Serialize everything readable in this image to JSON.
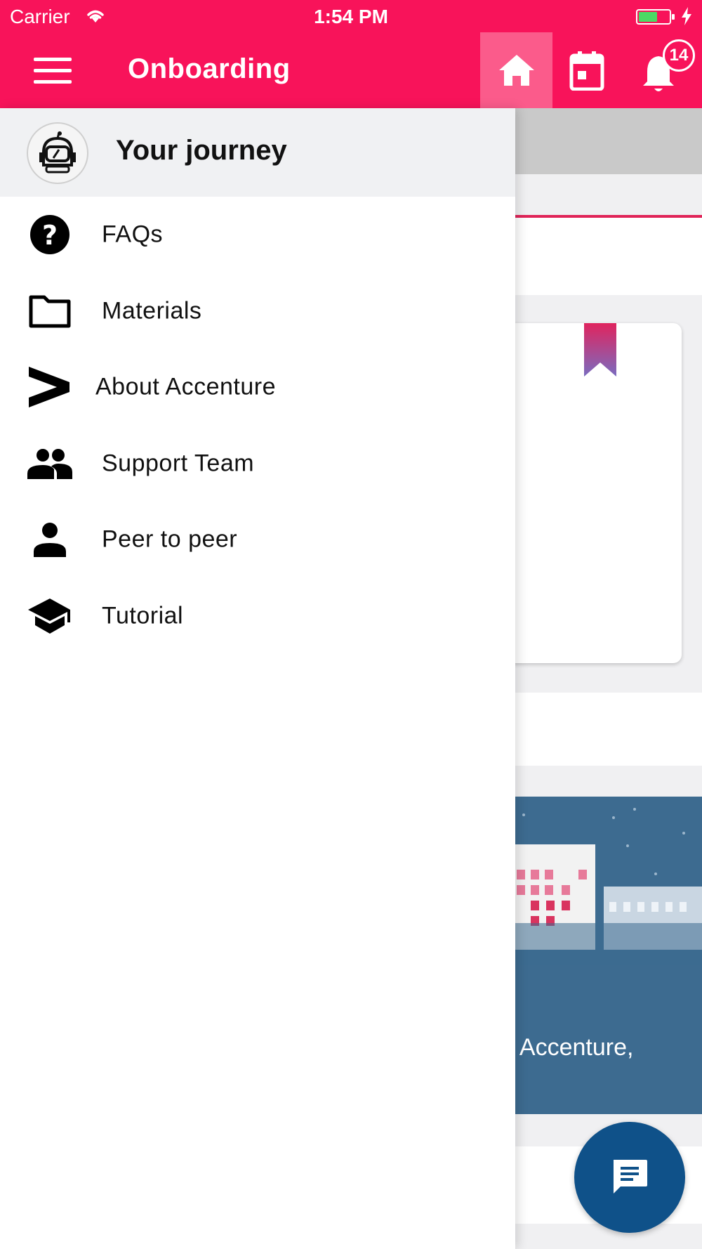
{
  "status_bar": {
    "carrier": "Carrier",
    "time": "1:54 PM"
  },
  "header": {
    "title": "Onboarding",
    "notification_count": "14",
    "colors": {
      "brand": "#f8135a",
      "active_tab": "#fb5b8b"
    }
  },
  "drawer": {
    "title": "Your journey",
    "items": [
      {
        "label": "FAQs",
        "icon": "help-circle-icon"
      },
      {
        "label": "Materials",
        "icon": "folder-icon"
      },
      {
        "label": "About Accenture",
        "icon": "accenture-logo-icon"
      },
      {
        "label": "Support Team",
        "icon": "group-icon"
      },
      {
        "label": "Peer to peer",
        "icon": "person-icon"
      },
      {
        "label": "Tutorial",
        "icon": "graduation-cap-icon"
      }
    ]
  },
  "background": {
    "banner_text": "to Accenture,",
    "colors": {
      "banner": "#3d6b90",
      "fab": "#0f5189"
    }
  }
}
